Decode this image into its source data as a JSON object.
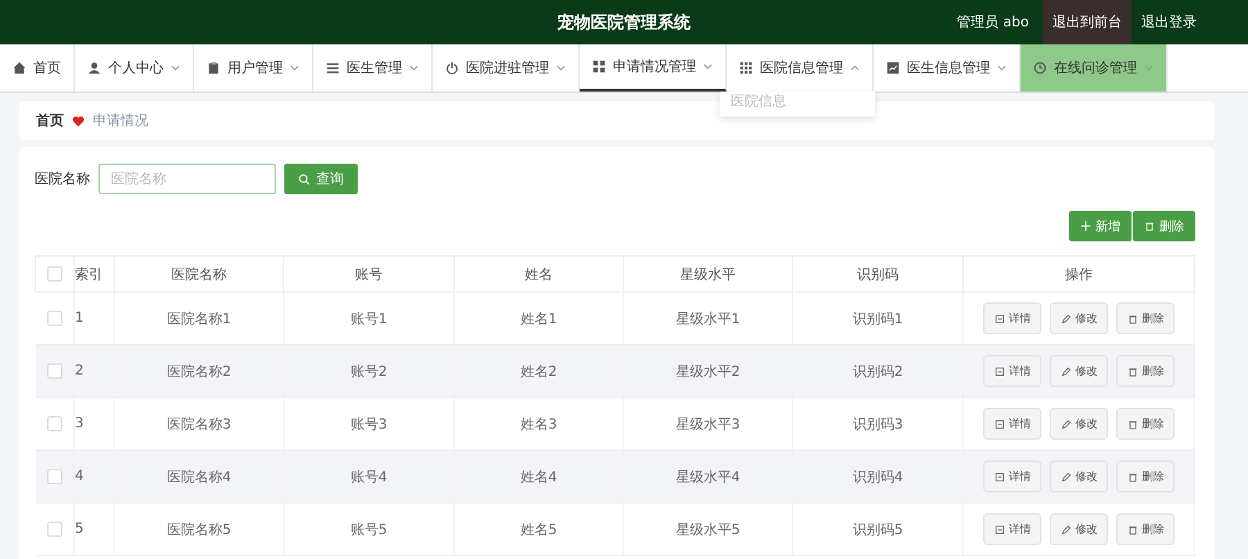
{
  "header": {
    "title": "宠物医院管理系统",
    "user": "管理员 abo",
    "links": [
      {
        "label": "退出到前台",
        "hovered": true
      },
      {
        "label": "退出登录",
        "hovered": false
      }
    ]
  },
  "nav": [
    {
      "label": "首页",
      "selected": false,
      "hovered": false
    },
    {
      "label": "个人中心",
      "selected": false,
      "hovered": false,
      "expanded": false
    },
    {
      "label": "用户管理",
      "selected": false,
      "hovered": false,
      "expanded": false
    },
    {
      "label": "医生管理",
      "selected": false,
      "hovered": false,
      "expanded": false
    },
    {
      "label": "医院进驻管理",
      "selected": false,
      "hovered": false,
      "expanded": false
    },
    {
      "label": "申请情况管理",
      "selected": true,
      "hovered": false,
      "expanded": false
    },
    {
      "label": "医院信息管理",
      "selected": false,
      "hovered": false,
      "expanded": true,
      "menu": [
        "医院信息"
      ]
    },
    {
      "label": "医生信息管理",
      "selected": false,
      "hovered": false,
      "expanded": false
    },
    {
      "label": "在线问诊管理",
      "selected": false,
      "hovered": true,
      "expanded": false
    }
  ],
  "breadcrumb": [
    "首页",
    "申请情况"
  ],
  "search": {
    "label": "医院名称",
    "placeholder": "医院名称",
    "button": "查询"
  },
  "toolbar": [
    "新增",
    "删除"
  ],
  "table": {
    "select_all": {
      "checked": false
    },
    "columns": [
      "索引",
      "医院名称",
      "账号",
      "姓名",
      "星级水平",
      "识别码",
      "操作"
    ],
    "rows": [
      {
        "checked": false,
        "cells": [
          "1",
          "医院名称1",
          "账号1",
          "姓名1",
          "星级水平1",
          "识别码1"
        ],
        "actions": [
          "详情",
          "修改",
          "删除"
        ]
      },
      {
        "checked": false,
        "cells": [
          "2",
          "医院名称2",
          "账号2",
          "姓名2",
          "星级水平2",
          "识别码2"
        ],
        "actions": [
          "详情",
          "修改",
          "删除"
        ]
      },
      {
        "checked": false,
        "cells": [
          "3",
          "医院名称3",
          "账号3",
          "姓名3",
          "星级水平3",
          "识别码3"
        ],
        "actions": [
          "详情",
          "修改",
          "删除"
        ]
      },
      {
        "checked": false,
        "cells": [
          "4",
          "医院名称4",
          "账号4",
          "姓名4",
          "星级水平4",
          "识别码4"
        ],
        "actions": [
          "详情",
          "修改",
          "删除"
        ]
      },
      {
        "checked": false,
        "cells": [
          "5",
          "医院名称5",
          "账号5",
          "姓名5",
          "星级水平5",
          "识别码5"
        ],
        "actions": [
          "详情",
          "修改",
          "删除"
        ]
      }
    ]
  }
}
